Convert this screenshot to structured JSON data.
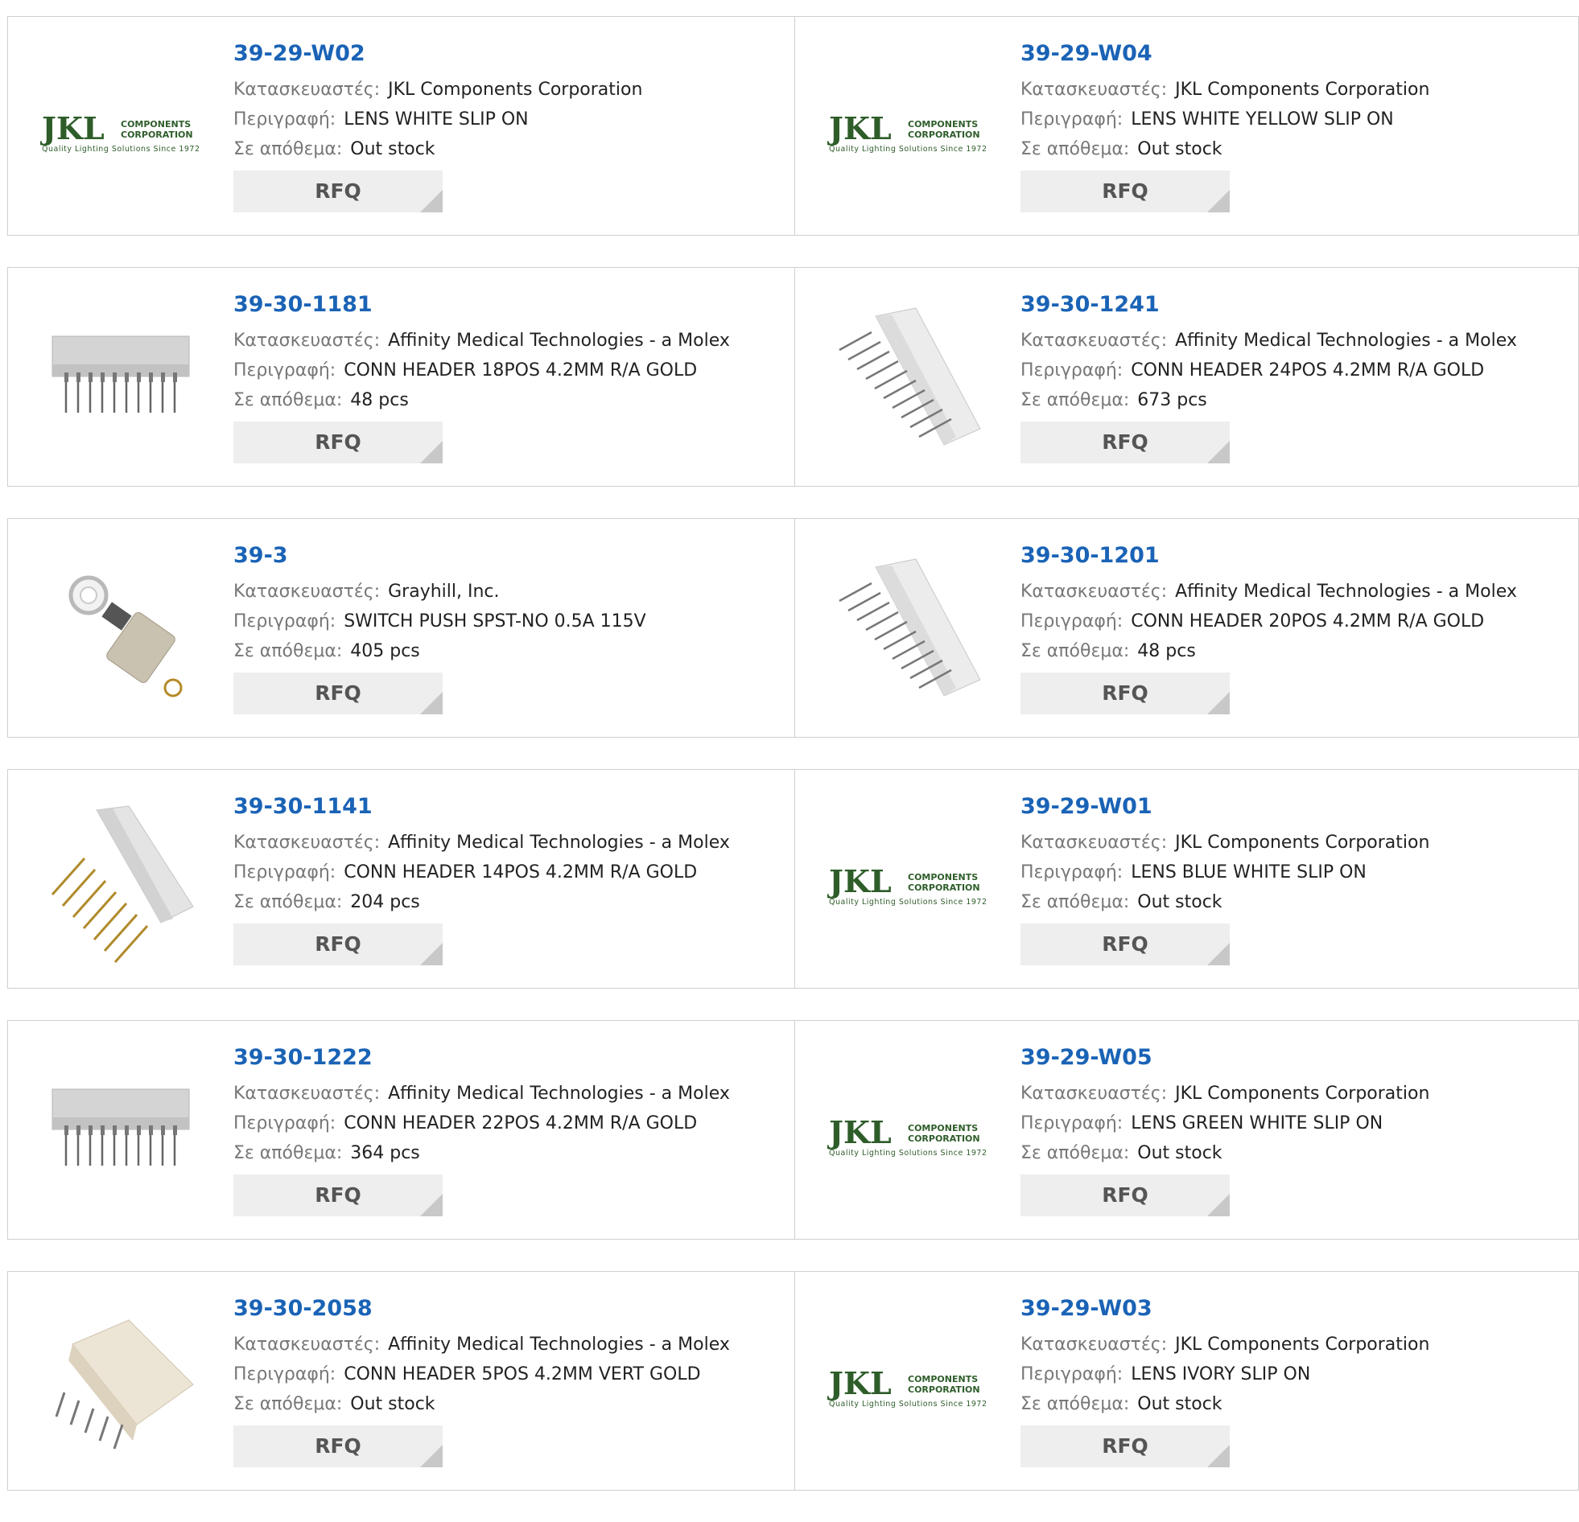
{
  "labels": {
    "manufacturer": "Κατασκευαστές:",
    "description": "Περιγραφή:",
    "stock": "Σε απόθεμα:",
    "rfq": "RFQ"
  },
  "logo": {
    "brand": "JKL",
    "line1": "COMPONENTS",
    "line2": "CORPORATION",
    "tagline": "Quality Lighting Solutions Since 1972"
  },
  "rows": [
    [
      {
        "part": "39-29-W02",
        "manufacturer": "JKL Components Corporation",
        "description": "LENS WHITE SLIP ON",
        "stock": "Out stock",
        "image": "jkl-logo"
      },
      {
        "part": "39-29-W04",
        "manufacturer": "JKL Components Corporation",
        "description": "LENS WHITE YELLOW SLIP ON",
        "stock": "Out stock",
        "image": "jkl-logo"
      }
    ],
    [
      {
        "part": "39-30-1181",
        "manufacturer": "Affinity Medical Technologies - a Molex",
        "description": "CONN HEADER 18POS 4.2MM R/A GOLD",
        "stock": "48 pcs",
        "image": "header-front"
      },
      {
        "part": "39-30-1241",
        "manufacturer": "Affinity Medical Technologies - a Molex",
        "description": "CONN HEADER 24POS 4.2MM R/A GOLD",
        "stock": "673 pcs",
        "image": "header-angled"
      }
    ],
    [
      {
        "part": "39-3",
        "manufacturer": "Grayhill, Inc.",
        "description": "SWITCH PUSH SPST-NO 0.5A 115V",
        "stock": "405 pcs",
        "image": "push-switch"
      },
      {
        "part": "39-30-1201",
        "manufacturer": "Affinity Medical Technologies - a Molex",
        "description": "CONN HEADER 20POS 4.2MM R/A GOLD",
        "stock": "48 pcs",
        "image": "header-angled"
      }
    ],
    [
      {
        "part": "39-30-1141",
        "manufacturer": "Affinity Medical Technologies - a Molex",
        "description": "CONN HEADER 14POS 4.2MM R/A GOLD",
        "stock": "204 pcs",
        "image": "header-gold"
      },
      {
        "part": "39-29-W01",
        "manufacturer": "JKL Components Corporation",
        "description": "LENS BLUE WHITE SLIP ON",
        "stock": "Out stock",
        "image": "jkl-logo"
      }
    ],
    [
      {
        "part": "39-30-1222",
        "manufacturer": "Affinity Medical Technologies - a Molex",
        "description": "CONN HEADER 22POS 4.2MM R/A GOLD",
        "stock": "364 pcs",
        "image": "header-front"
      },
      {
        "part": "39-29-W05",
        "manufacturer": "JKL Components Corporation",
        "description": "LENS GREEN WHITE SLIP ON",
        "stock": "Out stock",
        "image": "jkl-logo"
      }
    ],
    [
      {
        "part": "39-30-2058",
        "manufacturer": "Affinity Medical Technologies - a Molex",
        "description": "CONN HEADER 5POS 4.2MM VERT GOLD",
        "stock": "Out stock",
        "image": "header-vert"
      },
      {
        "part": "39-29-W03",
        "manufacturer": "JKL Components Corporation",
        "description": "LENS IVORY SLIP ON",
        "stock": "Out stock",
        "image": "jkl-logo"
      }
    ]
  ],
  "colors": {
    "part_link": "#1a63b6",
    "label": "#777777",
    "value": "#222222",
    "border": "#cfcfcf",
    "button_bg": "#eeeeee",
    "jkl_green": "#2e5d2a"
  }
}
